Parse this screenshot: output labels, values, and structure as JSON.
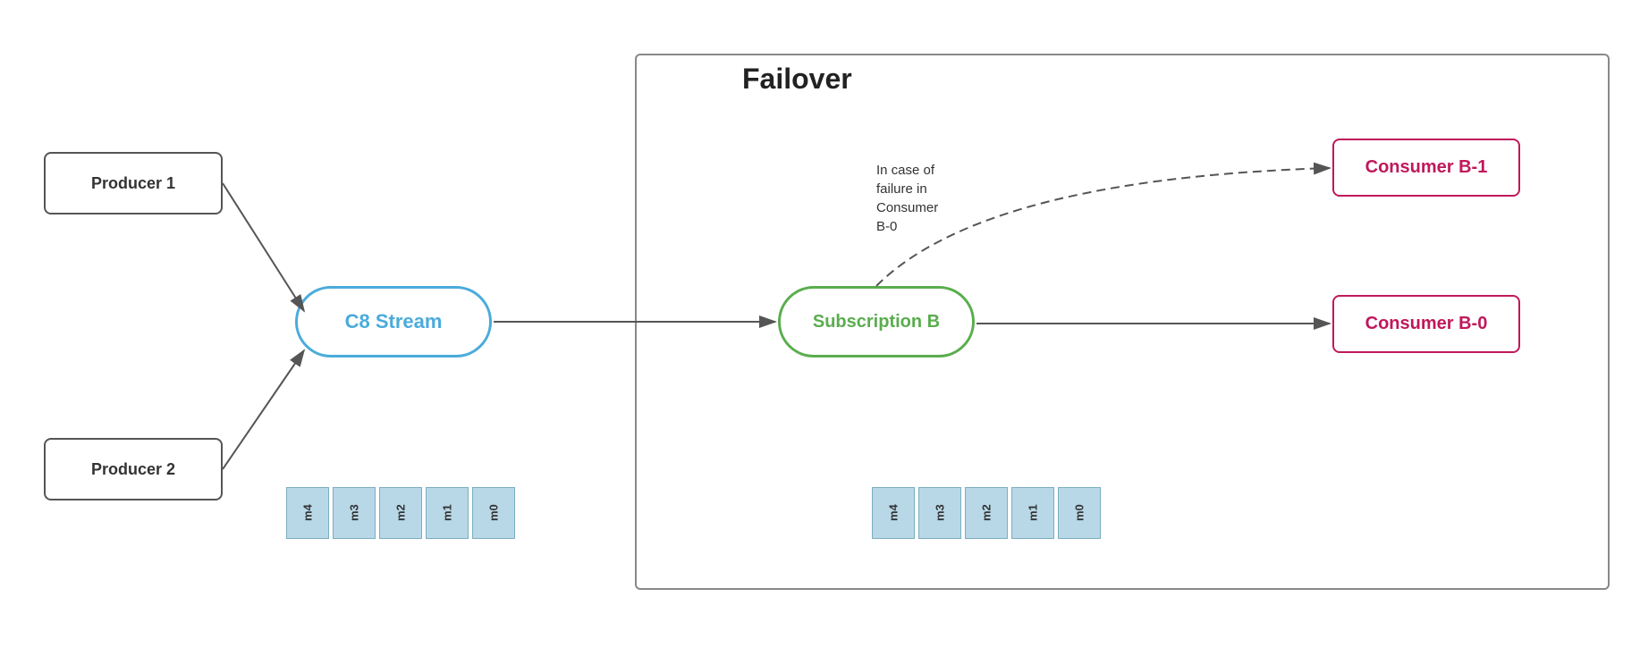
{
  "diagram": {
    "title": "Failover",
    "producer1_label": "Producer 1",
    "producer2_label": "Producer 2",
    "stream_label": "C8 Stream",
    "subscription_label": "Subscription B",
    "consumer_b1_label": "Consumer B-1",
    "consumer_b0_label": "Consumer B-0",
    "annotation_text": "In case of\nfailure in\nConsumer\nB-0",
    "queue1_messages": [
      "m4",
      "m3",
      "m2",
      "m1",
      "m0"
    ],
    "queue2_messages": [
      "m4",
      "m3",
      "m2",
      "m1",
      "m0"
    ]
  }
}
